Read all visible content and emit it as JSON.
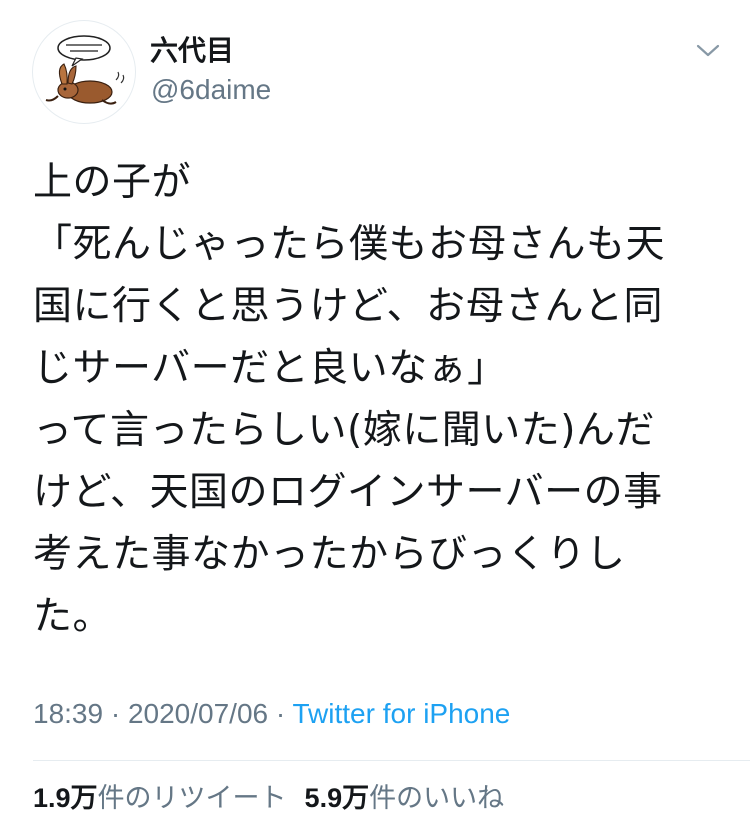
{
  "user": {
    "display_name": "六代目",
    "handle": "@6daime",
    "avatar_icon": "illustrated-rabbit-avatar",
    "avatar_speech_text": "Some kind of text"
  },
  "tweet": {
    "lines": [
      "上の子が",
      "「死んじゃったら僕もお母さんも天",
      "国に行くと思うけど、お母さんと同",
      "じサーバーだと良いなぁ」",
      "って言ったらしい(嫁に聞いた)んだ",
      "けど、天国のログインサーバーの事",
      "考えた事なかったからびっくりし",
      "た。"
    ],
    "time": "18:39",
    "date": "2020/07/06",
    "separator": "·",
    "source": "Twitter for iPhone"
  },
  "stats": {
    "retweets_count": "1.9万",
    "retweets_label": "件のリツイート",
    "likes_count": "5.9万",
    "likes_label": "件のいいね"
  },
  "icons": {
    "menu": "chevron-down-icon"
  },
  "colors": {
    "text": "#14171a",
    "secondary": "#657786",
    "link": "#1da1f2",
    "divider": "#e6ecf0"
  }
}
